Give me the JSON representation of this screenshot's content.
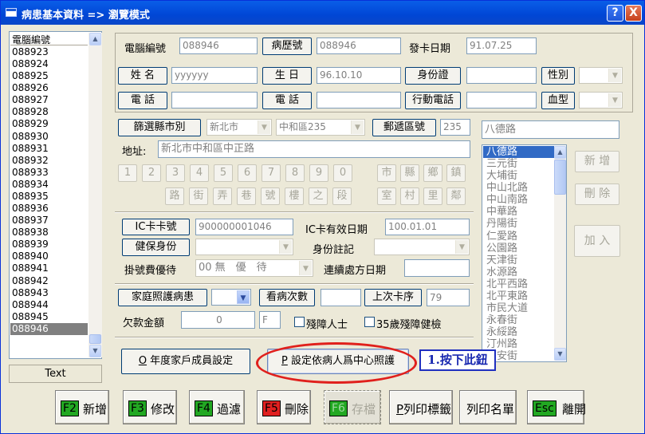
{
  "window": {
    "title": "病患基本資料 => 瀏覽模式",
    "help": "?",
    "close": "X"
  },
  "patient_list": {
    "header": "電腦編號",
    "items": [
      "088923",
      "088924",
      "088925",
      "088926",
      "088927",
      "088928",
      "088929",
      "088930",
      "088931",
      "088932",
      "088933",
      "088934",
      "088935",
      "088936",
      "088937",
      "088938",
      "088939",
      "088940",
      "088941",
      "088942",
      "088943",
      "088944",
      "088945",
      "088946"
    ],
    "selected": "088946"
  },
  "text_label": "Text",
  "form": {
    "computer_no_label": "電腦編號",
    "computer_no": "088946",
    "chart_no_button": "病歷號",
    "chart_no": "088946",
    "issue_date_label": "發卡日期",
    "issue_date": "91.07.25",
    "name_button": "姓 名",
    "name_value": "yyyyyy",
    "birth_button": "生 日",
    "birth_value": "96.10.10",
    "id_button": "身份證",
    "id_value": "",
    "gender_button": "性別",
    "gender_value": "",
    "phone_button_1": "電 話",
    "phone_value_1": "",
    "phone_button_2": "電 話",
    "phone_value_2": "",
    "mobile_button": "行動電話",
    "mobile_value": "",
    "blood_button": "血型",
    "blood_value": ""
  },
  "address": {
    "filter_button": "篩選縣市別",
    "city": "新北市",
    "district": "中和區235",
    "postal_label": "郵遞區號",
    "postal_code": "235",
    "road_input": "八德路",
    "address_label": "地址:",
    "address_value": "新北市中和區中正路",
    "numpad": [
      "1",
      "2",
      "3",
      "4",
      "5",
      "6",
      "7",
      "8",
      "9",
      "0"
    ],
    "word_row1": [
      "市",
      "縣",
      "鄉",
      "鎮"
    ],
    "word_row2": [
      "路",
      "街",
      "弄",
      "巷",
      "號",
      "樓",
      "之",
      "段"
    ],
    "word_row3": [
      "室",
      "村",
      "里",
      "鄰"
    ],
    "streets": [
      "八德路",
      "三元街",
      "大埔街",
      "中山北路",
      "中山南路",
      "中華路",
      "丹陽街",
      "仁愛路",
      "公園路",
      "天津街",
      "水源路",
      "北平西路",
      "北平東路",
      "市民大道",
      "永春街",
      "永綏路",
      "汀州路",
      "西安街"
    ],
    "selected_street": "八德路",
    "add_button": "新 增",
    "delete_button": "刪 除",
    "join_button": "加 入"
  },
  "ic_card": {
    "ic_no_button": "IC卡卡號",
    "ic_no": "900000001046",
    "ic_valid_label": "IC卡有效日期",
    "ic_valid": "100.01.01",
    "insurance_button": "健保身份",
    "insurance_value": "",
    "identity_note_label": "身份註記",
    "identity_note_value": "",
    "fee_priority_label": "掛號費優待",
    "fee_priority_value": "00 無　優　待",
    "continuous_rx_label": "連續處方日期",
    "continuous_rx_value": ""
  },
  "family": {
    "family_care_button": "家庭照護病患",
    "family_care_value": "",
    "visit_count_label": "看病次數",
    "visit_count": "",
    "last_card_label": "上次卡序",
    "last_card": "79",
    "debt_label": "欠款金額",
    "debt_amount": "0",
    "debt_flag": "F",
    "disabled_label": "殘障人士",
    "disabled_35_label": "35歲殘障健檢"
  },
  "actions": {
    "annual_family_button_key": "O",
    "annual_family_button": " 年度家戶成員設定",
    "center_care_button_key": "P",
    "center_care_button": " 設定依病人爲中心照護",
    "callout": "1.按下此鈕"
  },
  "toolbar": [
    {
      "key": "F2",
      "label": "新增",
      "key_color": "#22a822"
    },
    {
      "key": "F3",
      "label": "修改",
      "key_color": "#22a822"
    },
    {
      "key": "F4",
      "label": "過濾",
      "key_color": "#22a822"
    },
    {
      "key": "F5",
      "label": "刪除",
      "key_color": "#e02020"
    },
    {
      "key": "F6",
      "label": "存檔",
      "key_color": "#22a822"
    },
    {
      "key": "P",
      "label": "列印標籤",
      "key_color": ""
    },
    {
      "key": "",
      "label": "列印名單",
      "key_color": ""
    },
    {
      "key": "Esc",
      "label": "離開",
      "key_color": "#22a822"
    }
  ]
}
